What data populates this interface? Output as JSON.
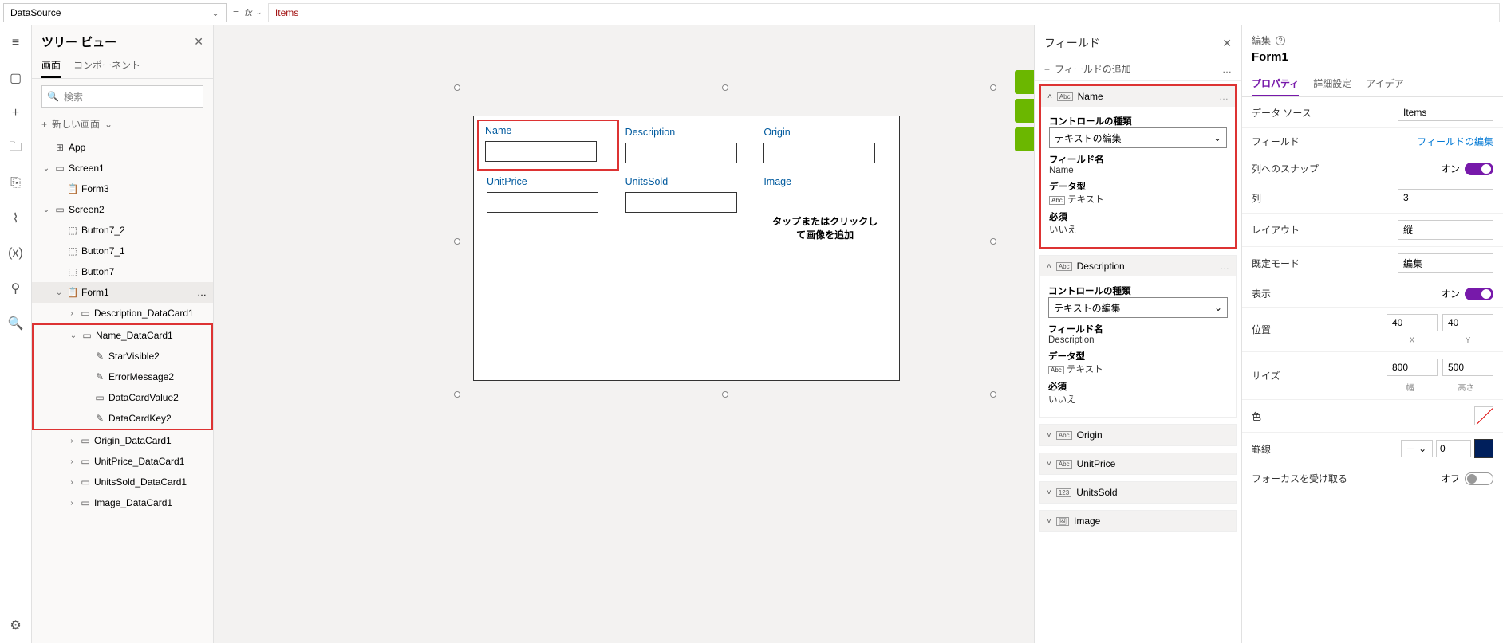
{
  "formula": {
    "property": "DataSource",
    "expression": "Items"
  },
  "tree": {
    "title": "ツリー ビュー",
    "tabs": {
      "screen": "画面",
      "components": "コンポーネント"
    },
    "search_placeholder": "検索",
    "new_screen": "新しい画面",
    "items": {
      "app": "App",
      "screen1": "Screen1",
      "form3": "Form3",
      "screen2": "Screen2",
      "button7_2": "Button7_2",
      "button7_1": "Button7_1",
      "button7": "Button7",
      "form1": "Form1",
      "description_dc": "Description_DataCard1",
      "name_dc": "Name_DataCard1",
      "star_visible2": "StarVisible2",
      "error_message2": "ErrorMessage2",
      "datacard_value2": "DataCardValue2",
      "datacard_key2": "DataCardKey2",
      "origin_dc": "Origin_DataCard1",
      "unitprice_dc": "UnitPrice_DataCard1",
      "unitssold_dc": "UnitsSold_DataCard1",
      "image_dc": "Image_DataCard1"
    }
  },
  "canvas": {
    "cards": {
      "name": "Name",
      "description": "Description",
      "origin": "Origin",
      "unitprice": "UnitPrice",
      "unitssold": "UnitsSold",
      "image": "Image",
      "image_placeholder": "タップまたはクリックして画像を追加"
    }
  },
  "fields": {
    "title": "フィールド",
    "add": "フィールドの追加",
    "control_type_label": "コントロールの種類",
    "control_type_value": "テキストの編集",
    "field_name_label": "フィールド名",
    "data_type_label": "データ型",
    "data_type_value": "テキスト",
    "required_label": "必須",
    "required_value": "いいえ",
    "name_field": "Name",
    "description_field": "Description",
    "origin_field": "Origin",
    "unitprice_field": "UnitPrice",
    "unitssold_field": "UnitsSold",
    "image_field": "Image"
  },
  "props": {
    "head": "編集",
    "name": "Form1",
    "tabs": {
      "properties": "プロパティ",
      "advanced": "詳細設定",
      "ideas": "アイデア"
    },
    "rows": {
      "datasource_label": "データ ソース",
      "datasource_value": "Items",
      "fields_label": "フィールド",
      "fields_link": "フィールドの編集",
      "snap_label": "列へのスナップ",
      "snap_value": "オン",
      "columns_label": "列",
      "columns_value": "3",
      "layout_label": "レイアウト",
      "layout_value": "縦",
      "defaultmode_label": "既定モード",
      "defaultmode_value": "編集",
      "visible_label": "表示",
      "visible_value": "オン",
      "position_label": "位置",
      "position_x": "40",
      "position_y": "40",
      "pos_x_lbl": "X",
      "pos_y_lbl": "Y",
      "size_label": "サイズ",
      "size_w": "800",
      "size_h": "500",
      "size_w_lbl": "幅",
      "size_h_lbl": "高さ",
      "color_label": "色",
      "border_label": "罫線",
      "border_width": "0",
      "focus_label": "フォーカスを受け取る",
      "focus_value": "オフ"
    }
  }
}
